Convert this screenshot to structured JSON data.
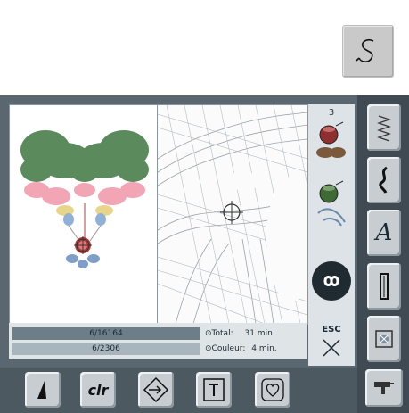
{
  "toolbar": {
    "stitch_button_icon": "stitch-s-icon"
  },
  "color_panel": {
    "top_number": "3",
    "colors": [
      {
        "icon": "thread-spool-icon",
        "color": "#8f2f2f"
      },
      {
        "icon": "thread-spool-icon",
        "color": "#3f6a35"
      }
    ]
  },
  "status": {
    "stitch_progress": "6/16164",
    "stitch_progress_fraction": 0.0004,
    "color_progress": "6/2306",
    "color_progress_fraction": 0.0026,
    "total_label": "Total:",
    "total_value": "31 min.",
    "color_label": "Couleur:",
    "color_value": "4 min."
  },
  "esc": {
    "label": "ESC"
  },
  "side_menu": [
    "zigzag-icon",
    "decorative-stitch-icon",
    "alphabet-icon",
    "buttonhole-icon",
    "embroidery-icon"
  ],
  "side_menu_alpha_label": "A",
  "bottom_menu": {
    "clr_label": "clr"
  },
  "colors": {
    "screen_bg": "#5a6770",
    "button_face": "#c7cdd1",
    "cloud_pink": "#f0a0b0",
    "bow_green": "#5a8a5a"
  }
}
